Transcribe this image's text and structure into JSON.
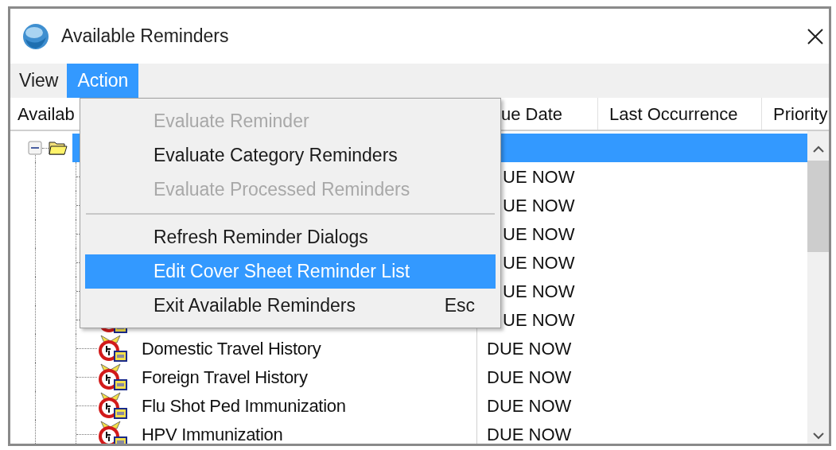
{
  "window": {
    "title": "Available Reminders"
  },
  "menu_bar": [
    {
      "label": "View",
      "selected": false
    },
    {
      "label": "Action",
      "selected": true
    }
  ],
  "columns": [
    "Availab",
    "ue Date",
    "Last Occurrence",
    "Priority"
  ],
  "tree": {
    "expanded": true,
    "selected": true,
    "children": [
      {
        "due": "UE NOW",
        "icon": false
      },
      {
        "due": "UE NOW",
        "icon": false
      },
      {
        "due": "UE NOW",
        "icon": false
      },
      {
        "due": "UE NOW",
        "icon": false
      },
      {
        "due": "UE NOW",
        "icon": false
      },
      {
        "due": "UE NOW",
        "icon": true
      },
      {
        "name": "Domestic Travel History",
        "due": "DUE NOW",
        "icon": true
      },
      {
        "name": "Foreign Travel History",
        "due": "DUE NOW",
        "icon": true
      },
      {
        "name": "Flu Shot Ped Immunization",
        "due": "DUE NOW",
        "icon": true
      },
      {
        "name": "HPV Immunization",
        "due": "DUE NOW",
        "icon": true
      }
    ]
  },
  "action_menu": [
    {
      "kind": "item",
      "label": "Evaluate Reminder",
      "disabled": true,
      "selected": false
    },
    {
      "kind": "item",
      "label": "Evaluate Category Reminders",
      "disabled": false,
      "selected": false
    },
    {
      "kind": "item",
      "label": "Evaluate Processed Reminders",
      "disabled": true,
      "selected": false
    },
    {
      "kind": "separator"
    },
    {
      "kind": "item",
      "label": "Refresh Reminder Dialogs",
      "disabled": false,
      "selected": false
    },
    {
      "kind": "item",
      "label": "Edit Cover Sheet Reminder List",
      "disabled": false,
      "selected": true
    },
    {
      "kind": "item",
      "label": "Exit Available Reminders",
      "shortcut": "Esc",
      "disabled": false,
      "selected": false
    }
  ]
}
